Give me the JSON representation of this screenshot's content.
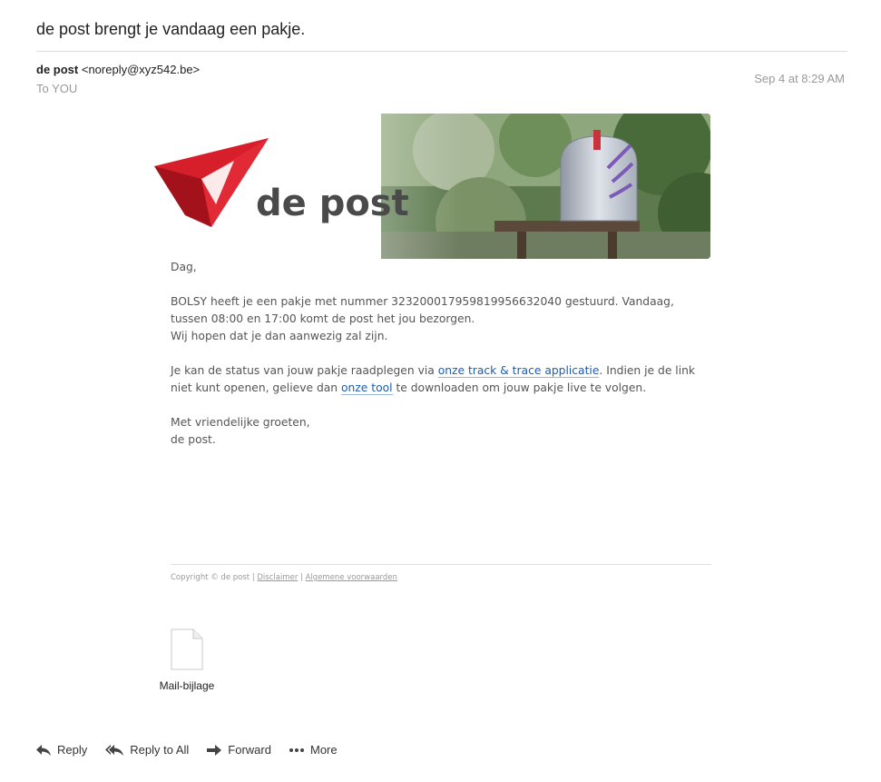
{
  "header": {
    "subject": "de post brengt je vandaag een pakje.",
    "sender_name": "de post",
    "sender_email": "<noreply@xyz542.be>",
    "to": "To YOU",
    "date": "Sep 4 at 8:29 AM"
  },
  "banner": {
    "logo_text": "de post"
  },
  "message": {
    "greeting": "Dag,",
    "p1_line1": "BOLSY heeft je een pakje met nummer 32320001795981995663 2040 gestuurd. Vandaag,",
    "p1_line2": "tussen 08:00 en 17:00 komt de post het jou bezorgen.",
    "p1_line3": "Wij hopen dat je dan aanwezig zal zijn.",
    "p2_pre": "Je kan de status van jouw pakje raadplegen via ",
    "p2_link1": "onze track & trace applicatie",
    "p2_mid": ". Indien je de link",
    "p2_line2_pre": "niet kunt openen, gelieve dan ",
    "p2_link2": "onze tool",
    "p2_post": " te downloaden om jouw pakje live te volgen.",
    "closing1": "Met vriendelijke groeten,",
    "closing2": "de post."
  },
  "footer": {
    "copyright": "Copyright © de post | ",
    "disclaimer": "Disclaimer",
    "sep": " | ",
    "terms": "Algemene voorwaarden"
  },
  "attachment": {
    "label": "Mail-bijlage"
  },
  "actions": {
    "reply": "Reply",
    "reply_all": "Reply to All",
    "forward": "Forward",
    "more": "More"
  },
  "colors": {
    "brand_red": "#d61f2b",
    "link": "#1a5db3"
  }
}
